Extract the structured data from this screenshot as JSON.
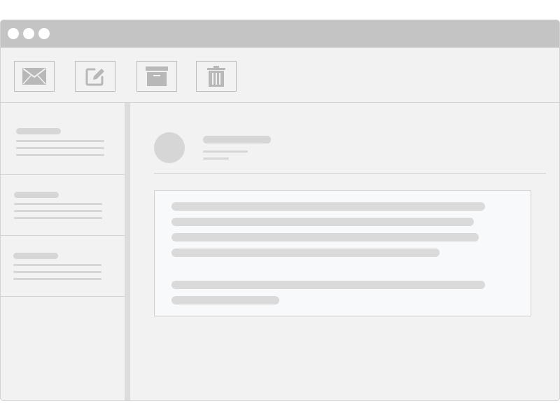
{
  "window": {
    "controls": [
      "close",
      "minimize",
      "maximize"
    ]
  },
  "toolbar": {
    "buttons": [
      {
        "icon": "envelope-icon",
        "action": "inbox"
      },
      {
        "icon": "compose-icon",
        "action": "compose"
      },
      {
        "icon": "archive-icon",
        "action": "archive"
      },
      {
        "icon": "trash-icon",
        "action": "delete"
      }
    ]
  },
  "colors": {
    "titlebar": "#c4c4c4",
    "window_bg": "#f2f2f2",
    "placeholder": "#d6d6d6",
    "icon": "#b8b8b8",
    "message_body_bg": "#f8f9fb"
  },
  "message_list": {
    "item_count": 3,
    "selected_index": null
  },
  "reader": {
    "sender_lines": 2,
    "body_paragraphs": [
      4,
      2
    ]
  }
}
